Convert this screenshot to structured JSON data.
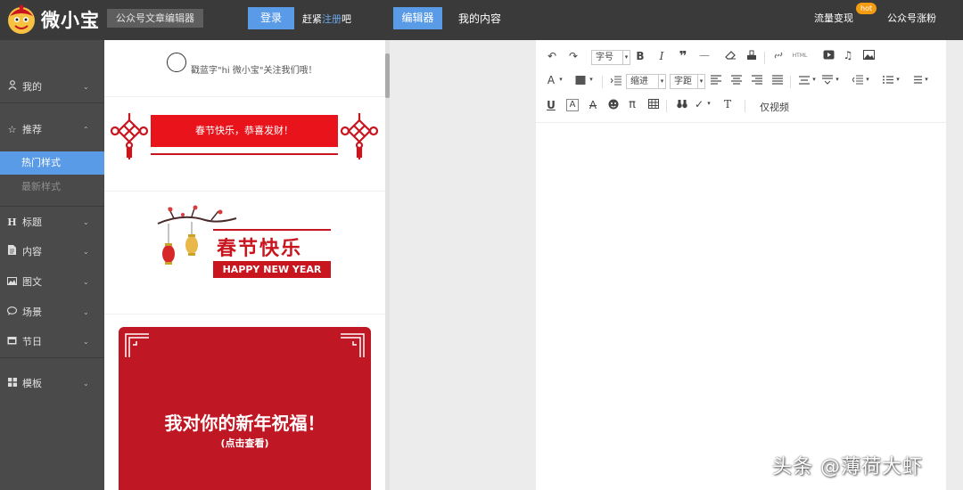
{
  "header": {
    "brand": "微小宝",
    "subtitle": "公众号文章编辑器",
    "login_label": "登录",
    "register_prefix": "赶紧",
    "register_link": "注册",
    "register_suffix": "吧",
    "editor_tab": "编辑器",
    "my_content_tab": "我的内容",
    "monetize_label": "流量变现",
    "hot_badge": "hot",
    "fans_label": "公众号涨粉"
  },
  "sidebar": {
    "items": [
      {
        "icon": "user-icon",
        "label": "我的",
        "chevron": "⌄"
      },
      {
        "icon": "star-icon",
        "label": "推荐",
        "chevron": "⌃"
      },
      {
        "icon": "heading-icon",
        "label": "标题",
        "chevron": "⌄"
      },
      {
        "icon": "document-icon",
        "label": "内容",
        "chevron": "⌄"
      },
      {
        "icon": "image-icon",
        "label": "图文",
        "chevron": "⌄"
      },
      {
        "icon": "chat-icon",
        "label": "场景",
        "chevron": "⌄"
      },
      {
        "icon": "calendar-icon",
        "label": "节日",
        "chevron": "⌄"
      },
      {
        "icon": "grid-icon",
        "label": "模板",
        "chevron": "⌄"
      }
    ],
    "sub_items": [
      "热门样式",
      "最新样式"
    ],
    "active_sub": "热门样式"
  },
  "styles": {
    "follow_text": "戳蓝字\"hi 微小宝\"关注我们哦！",
    "banner_text": "春节快乐，恭喜发财！",
    "new_year_cn": "春节快乐",
    "new_year_en": "HAPPY NEW YEAR",
    "card_title": "我对你的新年祝福！",
    "card_subtitle": "(点击查看)"
  },
  "toolbar": {
    "font_size": "字号",
    "bold": "B",
    "italic": "I",
    "quote": "❞",
    "hr": "—",
    "html": "HTML",
    "indent": "缩进",
    "spacing": "字距",
    "pi": "π",
    "text_t": "T",
    "video_only": "仅视频",
    "underline": "U"
  },
  "colors": {
    "topbar": "#3a3a3a",
    "accent": "#5a9be8",
    "sidebar": "#4a4a4a",
    "red": "#c8151e",
    "hot": "#f39c12"
  },
  "watermark": "头条 @薄荷大虾"
}
